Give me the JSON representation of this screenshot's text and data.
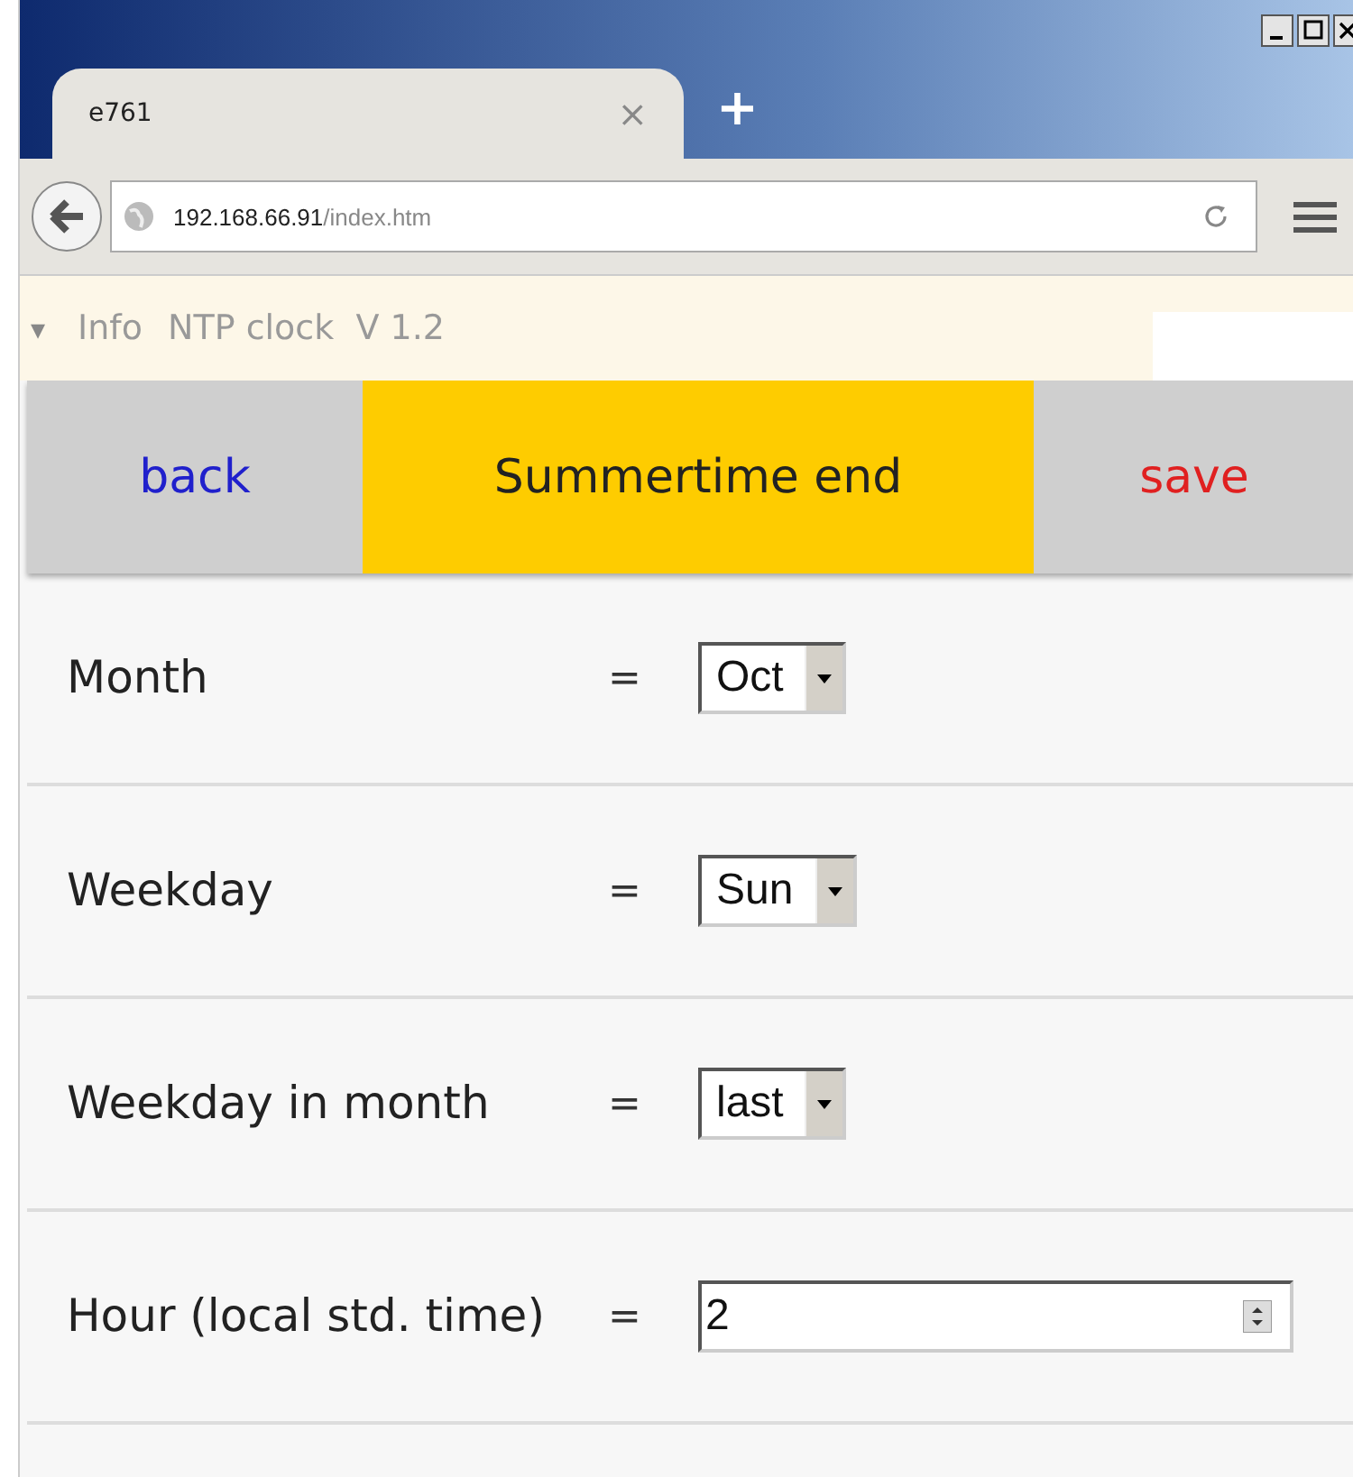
{
  "browser": {
    "tab": {
      "title": "e761",
      "close": "×"
    },
    "new_tab": "+",
    "address": {
      "host": "192.168.66.91",
      "path": "/index.htm"
    }
  },
  "info_bar": {
    "toggle": "▾",
    "label": "Info",
    "text": "NTP clock  V 1.2"
  },
  "header": {
    "back": "back",
    "title": "Summertime end",
    "save": "save"
  },
  "rows": [
    {
      "kind": "select",
      "label": "Month",
      "eq": "=",
      "value": "Oct"
    },
    {
      "kind": "select",
      "label": "Weekday",
      "eq": "=",
      "value": "Sun"
    },
    {
      "kind": "select",
      "label": "Weekday in month",
      "eq": "=",
      "value": "last"
    },
    {
      "kind": "number",
      "label": "Hour (local std. time)",
      "eq": "=",
      "value": "2"
    }
  ]
}
